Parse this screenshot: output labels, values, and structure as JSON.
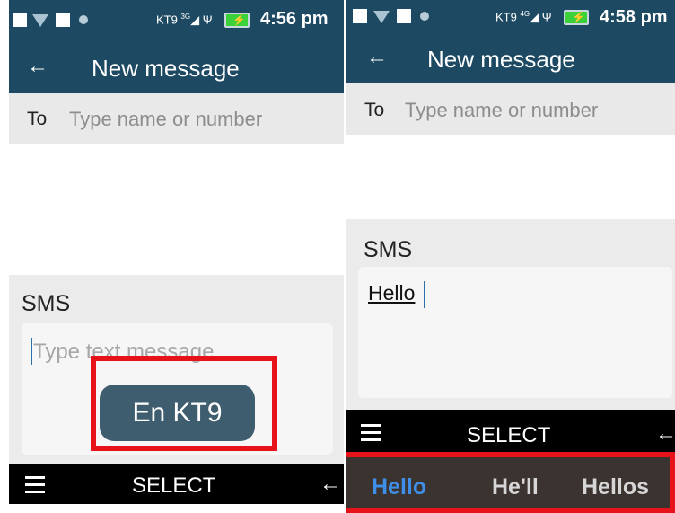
{
  "left_screen": {
    "status": {
      "carrier": "KT9",
      "network": "3G",
      "usb": "Ψ",
      "time": "4:56 pm"
    },
    "header": {
      "back_glyph": "←",
      "title": "New message"
    },
    "to": {
      "label": "To",
      "placeholder": "Type name or number"
    },
    "sms_label": "SMS",
    "message": {
      "placeholder": "Type text message"
    },
    "ime_indicator": "En KT9",
    "softkeys": {
      "center": "SELECT",
      "right_glyph": "←"
    }
  },
  "right_screen": {
    "status": {
      "carrier": "KT9",
      "network": "4G",
      "usb": "Ψ",
      "time": "4:58 pm"
    },
    "header": {
      "back_glyph": "←",
      "title": "New message"
    },
    "to": {
      "label": "To",
      "placeholder": "Type name or number"
    },
    "sms_label": "SMS",
    "message": {
      "value": "Hello"
    },
    "softkeys": {
      "center": "SELECT",
      "right_glyph": "←"
    },
    "suggestions": [
      "Hello",
      "He'll",
      "Hellos"
    ],
    "suggestion_selected": "Hello"
  },
  "colors": {
    "header": "#1d4a62",
    "highlight": "#e8121b",
    "suggestion_active": "#3f8ee8"
  },
  "icons": [
    "square-notification-icon",
    "wifi-icon",
    "circle-notification-icon",
    "signal-icon",
    "usb-icon",
    "battery-charging-icon",
    "back-arrow-icon",
    "hamburger-menu-icon"
  ]
}
